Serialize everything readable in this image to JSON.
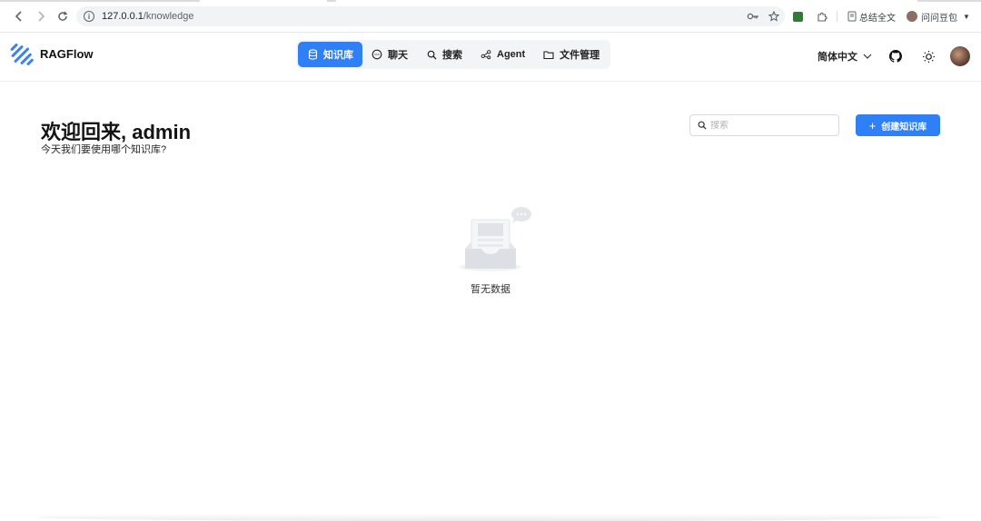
{
  "browser": {
    "url_host": "127.0.0.1",
    "url_path": "/knowledge",
    "extensions": {
      "summary_label": "总结全文",
      "profile_label": "问问豆包"
    }
  },
  "header": {
    "brand": "RAGFlow",
    "nav": [
      {
        "label": "知识库",
        "icon": "database-icon",
        "active": true
      },
      {
        "label": "聊天",
        "icon": "chat-bubble-icon",
        "active": false
      },
      {
        "label": "搜索",
        "icon": "search-icon",
        "active": false
      },
      {
        "label": "Agent",
        "icon": "agent-graph-icon",
        "active": false
      },
      {
        "label": "文件管理",
        "icon": "folder-icon",
        "active": false
      }
    ],
    "language": "简体中文"
  },
  "main": {
    "welcome": "欢迎回来, admin",
    "subtitle": "今天我们要使用哪个知识库?",
    "search_placeholder": "搜索",
    "create_label": "创建知识库",
    "empty_text": "暂无数据"
  },
  "colors": {
    "accent": "#2f7ff6",
    "logo": "#3b82f6"
  }
}
